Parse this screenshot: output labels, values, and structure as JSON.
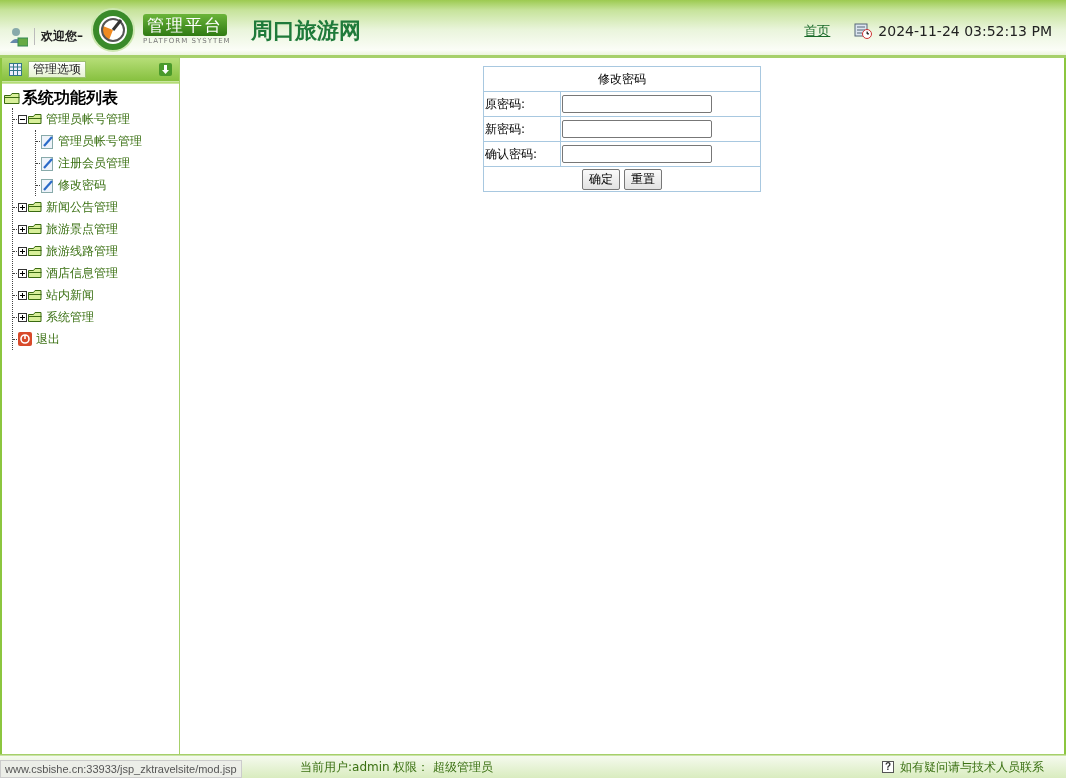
{
  "header": {
    "welcome": "欢迎您–",
    "logo_title": "管理平台",
    "logo_subtitle": "PLATFORM SYSYTEM",
    "site_name": "周口旅游网",
    "home_link": "首页",
    "datetime": "2024-11-24 03:52:13 PM"
  },
  "sidebar": {
    "title": "管理选项",
    "tree": {
      "label": "系统功能列表",
      "expanded": true,
      "children": [
        {
          "label": "管理员帐号管理",
          "kind": "folder",
          "expanded": true,
          "children": [
            {
              "label": "管理员帐号管理",
              "kind": "page"
            },
            {
              "label": "注册会员管理",
              "kind": "page"
            },
            {
              "label": "修改密码",
              "kind": "page"
            }
          ]
        },
        {
          "label": "新闻公告管理",
          "kind": "folder",
          "expanded": false
        },
        {
          "label": "旅游景点管理",
          "kind": "folder",
          "expanded": false
        },
        {
          "label": "旅游线路管理",
          "kind": "folder",
          "expanded": false
        },
        {
          "label": "酒店信息管理",
          "kind": "folder",
          "expanded": false
        },
        {
          "label": "站内新闻",
          "kind": "folder",
          "expanded": false
        },
        {
          "label": "系统管理",
          "kind": "folder",
          "expanded": false
        },
        {
          "label": "退出",
          "kind": "exit"
        }
      ]
    }
  },
  "form": {
    "title": "修改密码",
    "fields": [
      {
        "label": "原密码:"
      },
      {
        "label": "新密码:"
      },
      {
        "label": "确认密码:"
      }
    ],
    "buttons": [
      "确定",
      "重置"
    ]
  },
  "status_bar": {
    "user": "当前用户:admin 权限： 超级管理员",
    "help_icon": "?",
    "help": "如有疑问请与技术人员联系"
  },
  "link_status": "www.csbishe.cn:33933/jsp_zktravelsite/mod.jsp"
}
